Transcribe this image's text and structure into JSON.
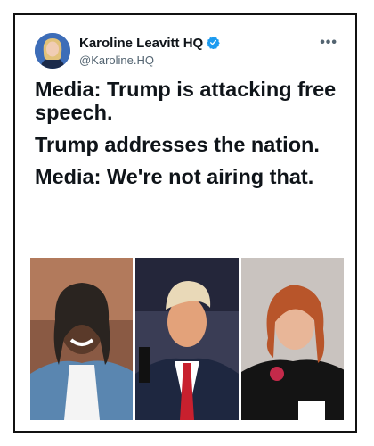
{
  "tweet": {
    "display_name": "Karoline Leavitt HQ",
    "handle": "@Karoline.HQ",
    "more_label": "•••",
    "lines": [
      "Media: Trump is attacking free speech.",
      "Trump addresses the nation.",
      "Media: We're not airing that."
    ]
  },
  "icons": {
    "verified": "verified-check-icon",
    "more": "more-options-icon"
  },
  "colors": {
    "verified": "#1d9bf0",
    "text": "#0f1419",
    "secondary": "#536471"
  }
}
